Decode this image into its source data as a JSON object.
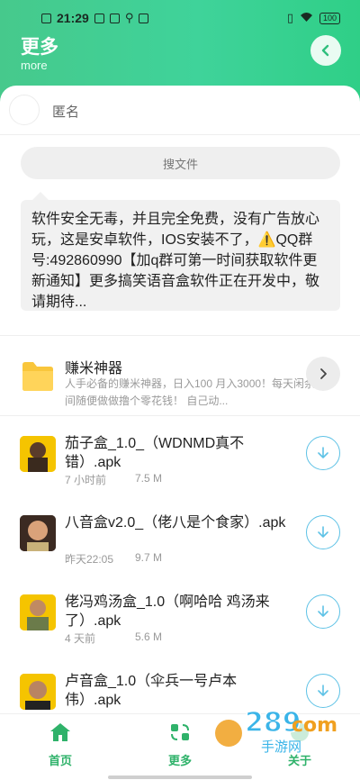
{
  "status_bar": {
    "time": "21:29",
    "battery": "100"
  },
  "header": {
    "title": "更多",
    "subtitle": "more"
  },
  "user": {
    "name": "匿名"
  },
  "search": {
    "label": "搜文件"
  },
  "notice": {
    "text": "软件安全无毒，并且完全免费，没有广告放心玩，这是安卓软件，IOS安装不了，⚠️QQ群号:492860990【加q群可第一时间获取软件更新通知】更多搞笑语音盒软件正在开发中，敬请期待..."
  },
  "feature": {
    "title": "赚米神器",
    "description": "人手必备的赚米神器，日入100 月入3000！每天闲余时间随便做做撸个零花钱！    自己动..."
  },
  "files": [
    {
      "name": "茄子盒_1.0_（WDNMD真不错）.apk",
      "time": "7 小时前",
      "size": "7.5 M"
    },
    {
      "name": "八音盒v2.0_（佬八是个食家）.apk",
      "time": "昨天22:05",
      "size": "9.7 M"
    },
    {
      "name": "佬冯鸡汤盒_1.0（啊哈哈 鸡汤来了）.apk",
      "time": "4 天前",
      "size": "5.6 M"
    },
    {
      "name": "卢音盒_1.0（伞兵一号卢本伟）.apk",
      "time": "",
      "size": ""
    }
  ],
  "tabs": [
    {
      "label": "首页"
    },
    {
      "label": "更多"
    },
    {
      "label": "关于"
    }
  ],
  "watermark": {
    "top": "289",
    "bottom": "手游网"
  },
  "colors": {
    "accent": "#3dcf8f",
    "download": "#5ec2e6",
    "tab_active": "#2fb26a"
  }
}
